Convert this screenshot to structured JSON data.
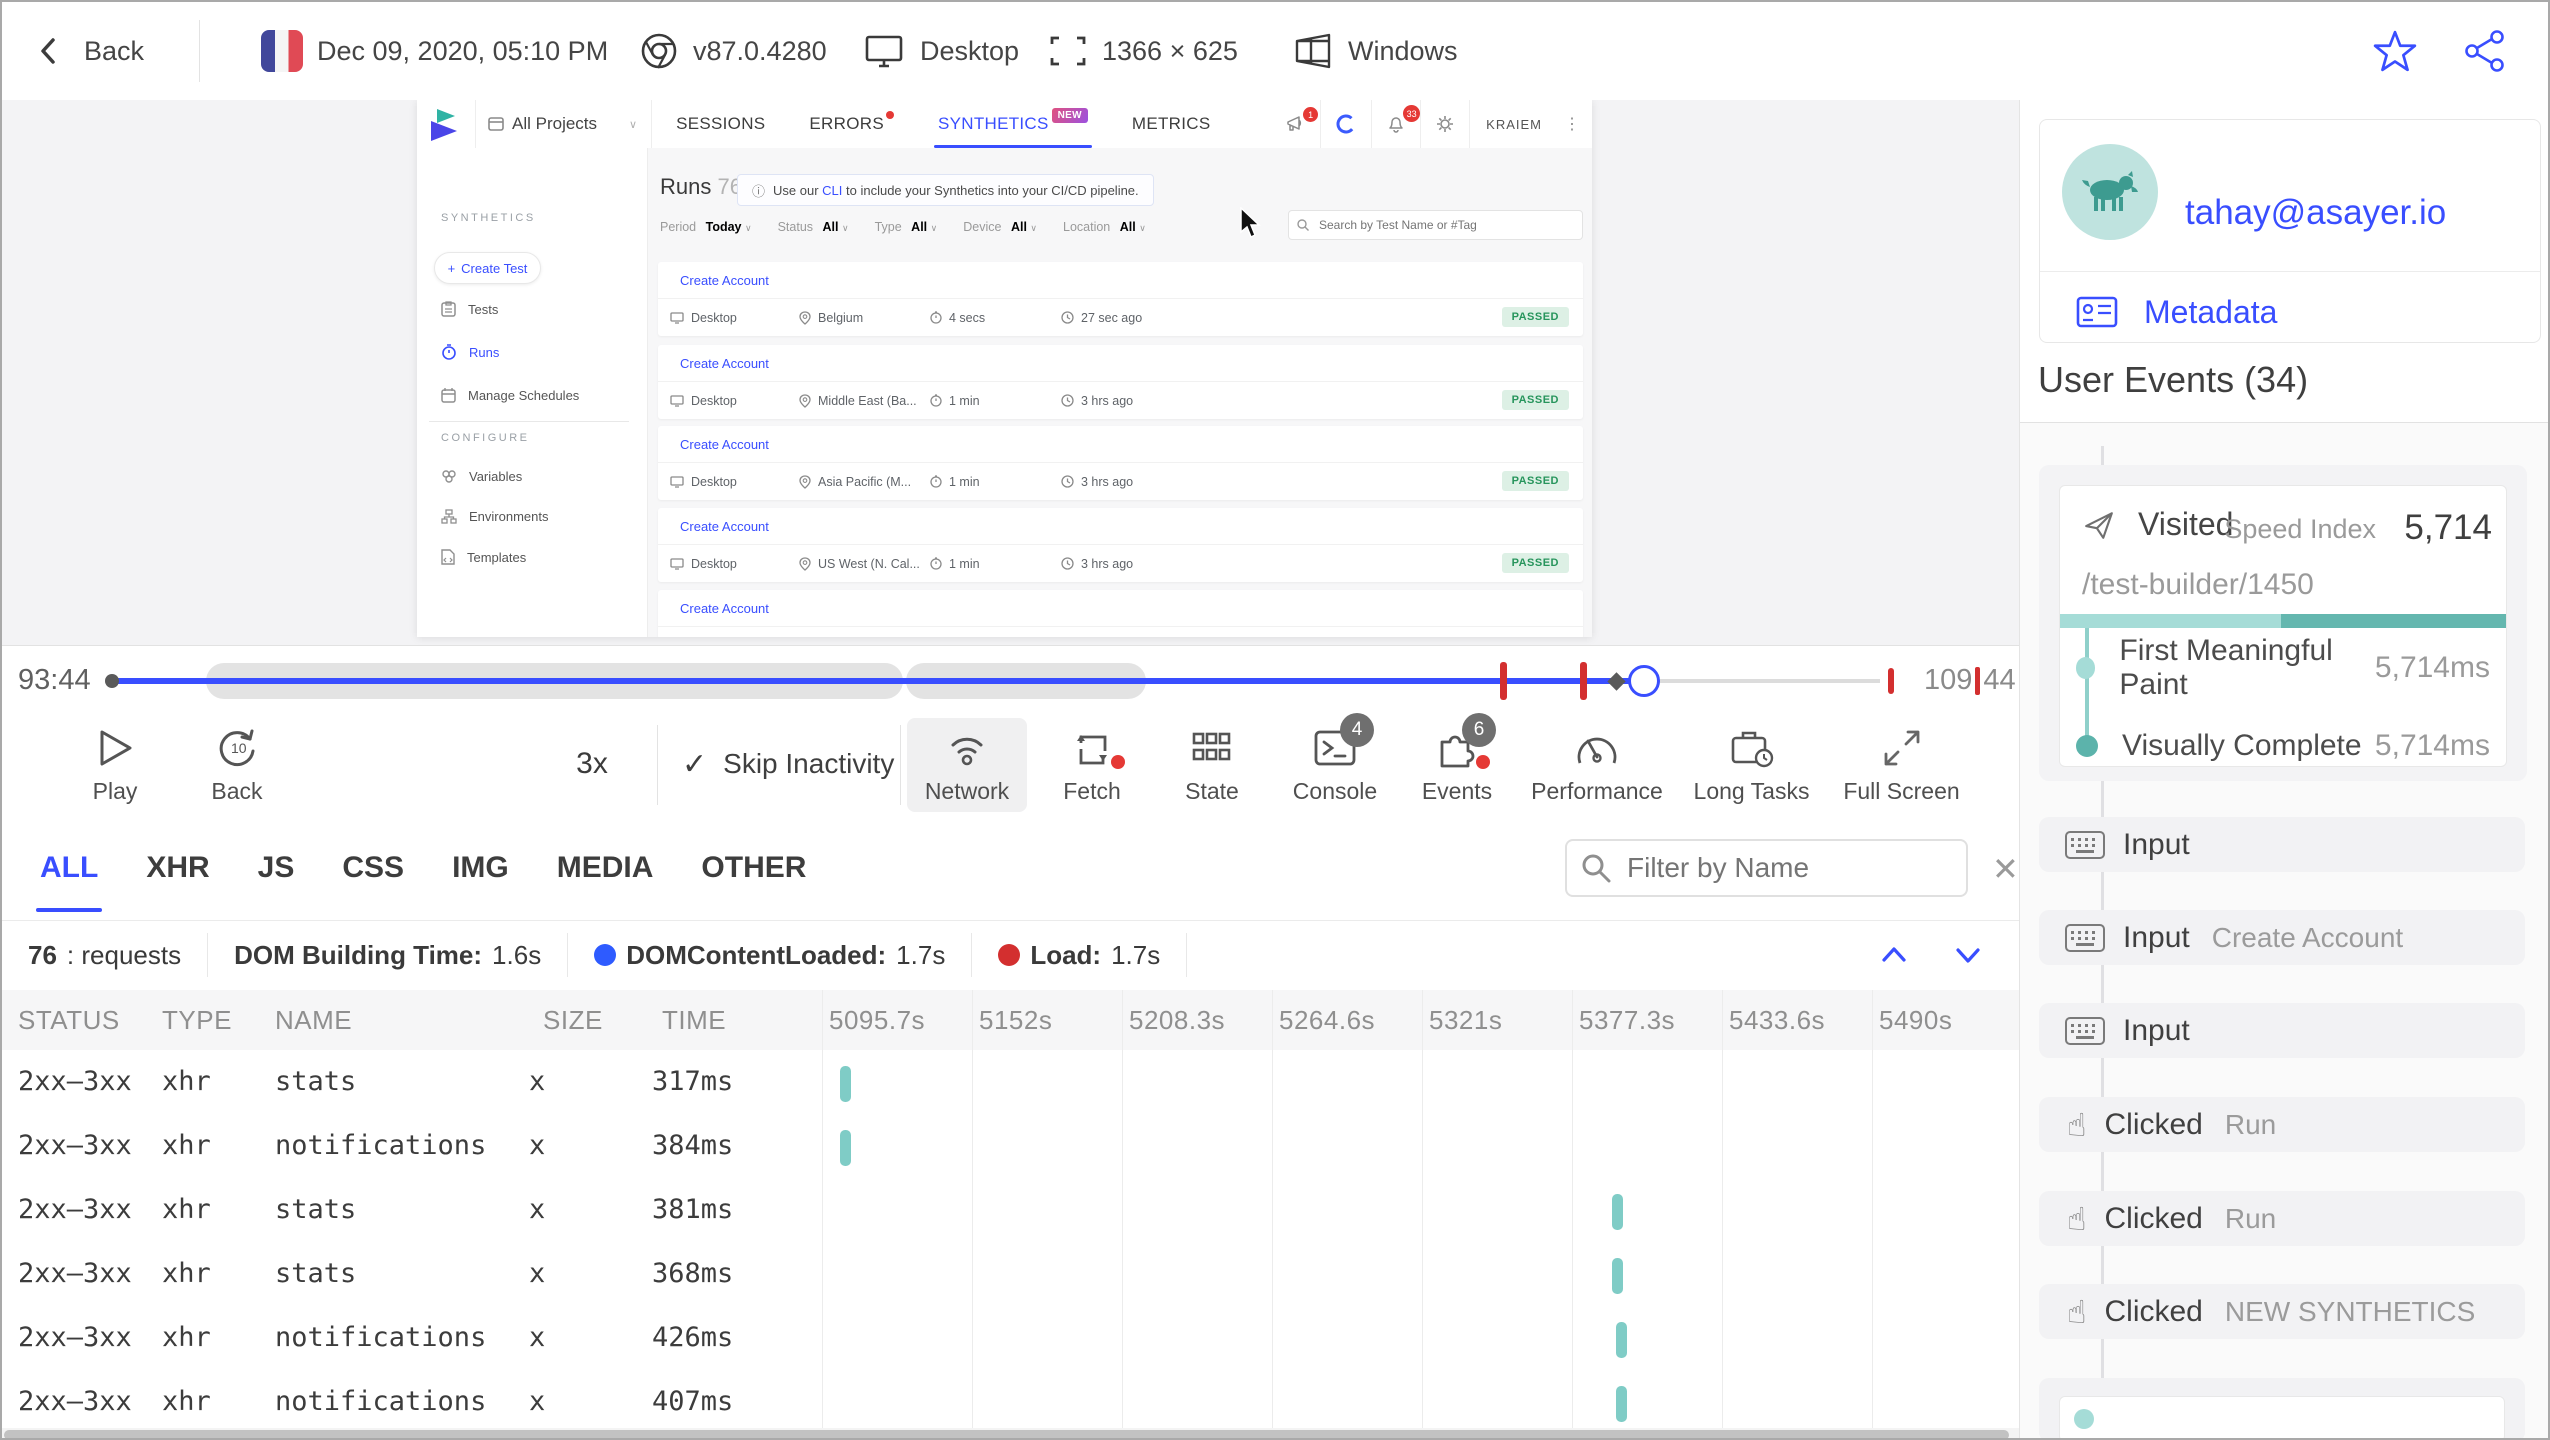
{
  "top_bar": {
    "back_label": "Back",
    "timestamp": "Dec 09, 2020, 05:10 PM",
    "browser_version": "v87.0.4280",
    "device": "Desktop",
    "resolution": "1366 × 625",
    "os": "Windows"
  },
  "replay_app": {
    "nav": {
      "project_selector": "All Projects",
      "tab_sessions": "SESSIONS",
      "tab_errors": "ERRORS",
      "tab_synthetics": "SYNTHETICS",
      "tab_synthetics_badge": "NEW",
      "tab_metrics": "METRICS",
      "announce_badge": "1",
      "bell_badge": "33",
      "username": "KRAIEM"
    },
    "sidebar": {
      "section_synthetics": "SYNTHETICS",
      "create_test": "Create Test",
      "item_tests": "Tests",
      "item_runs": "Runs",
      "item_schedules": "Manage Schedules",
      "section_configure": "CONFIGURE",
      "item_variables": "Variables",
      "item_environments": "Environments",
      "item_templates": "Templates"
    },
    "runs": {
      "title": "Runs",
      "count": "76",
      "banner_pre": "Use our ",
      "banner_link": "CLI",
      "banner_post": " to include your Synthetics into your CI/CD pipeline.",
      "filters": [
        {
          "label": "Period",
          "value": "Today"
        },
        {
          "label": "Status",
          "value": "All"
        },
        {
          "label": "Type",
          "value": "All"
        },
        {
          "label": "Device",
          "value": "All"
        },
        {
          "label": "Location",
          "value": "All"
        }
      ],
      "search_placeholder": "Search by Test Name or #Tag",
      "list": [
        {
          "name": "Create Account",
          "device": "Desktop",
          "location": "Belgium",
          "duration": "4 secs",
          "ago": "27 sec ago",
          "status": "PASSED"
        },
        {
          "name": "Create Account",
          "device": "Desktop",
          "location": "Middle East (Ba...",
          "duration": "1 min",
          "ago": "3 hrs ago",
          "status": "PASSED"
        },
        {
          "name": "Create Account",
          "device": "Desktop",
          "location": "Asia Pacific (M...",
          "duration": "1 min",
          "ago": "3 hrs ago",
          "status": "PASSED"
        },
        {
          "name": "Create Account",
          "device": "Desktop",
          "location": "US West (N. Cal...",
          "duration": "1 min",
          "ago": "3 hrs ago",
          "status": "PASSED"
        },
        {
          "name": "Create Account",
          "device": "Desktop",
          "location": "",
          "duration": "",
          "ago": "",
          "status": ""
        }
      ]
    }
  },
  "player": {
    "time_start": "93:44",
    "time_end_left": "109",
    "time_end_right": "44",
    "play_label": "Play",
    "back_label": "Back",
    "back_amount": "10",
    "speed": "3x",
    "skip_label": "Skip Inactivity",
    "network_label": "Network",
    "fetch_label": "Fetch",
    "state_label": "State",
    "console_label": "Console",
    "console_badge": "4",
    "events_label": "Events",
    "events_badge": "6",
    "performance_label": "Performance",
    "longtasks_label": "Long Tasks",
    "fullscreen_label": "Full Screen"
  },
  "network_panel": {
    "tabs": [
      "ALL",
      "XHR",
      "JS",
      "CSS",
      "IMG",
      "MEDIA",
      "OTHER"
    ],
    "filter_placeholder": "Filter by Name",
    "summary": {
      "requests_count": "76",
      "requests_label": ": requests",
      "dom_building_label": "DOM Building Time:",
      "dom_building_value": "1.6s",
      "dcl_label": "DOMContentLoaded:",
      "dcl_value": "1.7s",
      "load_label": "Load:",
      "load_value": "1.7s"
    },
    "columns": {
      "status": "STATUS",
      "type": "TYPE",
      "name": "NAME",
      "size": "SIZE",
      "time": "TIME"
    },
    "time_columns": [
      "5095.7s",
      "5152s",
      "5208.3s",
      "5264.6s",
      "5321s",
      "5377.3s",
      "5433.6s",
      "5490s"
    ],
    "rows": [
      {
        "status": "2xx–3xx",
        "type": "xhr",
        "name": "stats",
        "size": "x",
        "time": "317ms"
      },
      {
        "status": "2xx–3xx",
        "type": "xhr",
        "name": "notifications",
        "size": "x",
        "time": "384ms"
      },
      {
        "status": "2xx–3xx",
        "type": "xhr",
        "name": "stats",
        "size": "x",
        "time": "381ms"
      },
      {
        "status": "2xx–3xx",
        "type": "xhr",
        "name": "stats",
        "size": "x",
        "time": "368ms"
      },
      {
        "status": "2xx–3xx",
        "type": "xhr",
        "name": "notifications",
        "size": "x",
        "time": "426ms"
      },
      {
        "status": "2xx–3xx",
        "type": "xhr",
        "name": "notifications",
        "size": "x",
        "time": "407ms"
      }
    ]
  },
  "user_panel": {
    "email": "tahay@asayer.io",
    "metadata_label": "Metadata",
    "events_title": "User Events (34)",
    "visited": {
      "label": "Visited",
      "speed_index_label": "Speed Index",
      "speed_index_value": "5,714",
      "url": "/test-builder/1450",
      "metrics": [
        {
          "label": "First Meaningful Paint",
          "value": "5,714ms"
        },
        {
          "label": "Visually Complete",
          "value": "5,714ms"
        }
      ]
    },
    "events": [
      {
        "label": "Input",
        "value": ""
      },
      {
        "label": "Input",
        "value": "Create Account"
      },
      {
        "label": "Input",
        "value": ""
      },
      {
        "label": "Clicked",
        "value": "Run"
      },
      {
        "label": "Clicked",
        "value": "Run"
      },
      {
        "label": "Clicked",
        "value": "NEW SYNTHETICS"
      }
    ]
  },
  "colors": {
    "accent": "#394eff",
    "teal_bar": "#7fccc6",
    "red": "#d32f2f",
    "passed_green": "#27955c"
  }
}
